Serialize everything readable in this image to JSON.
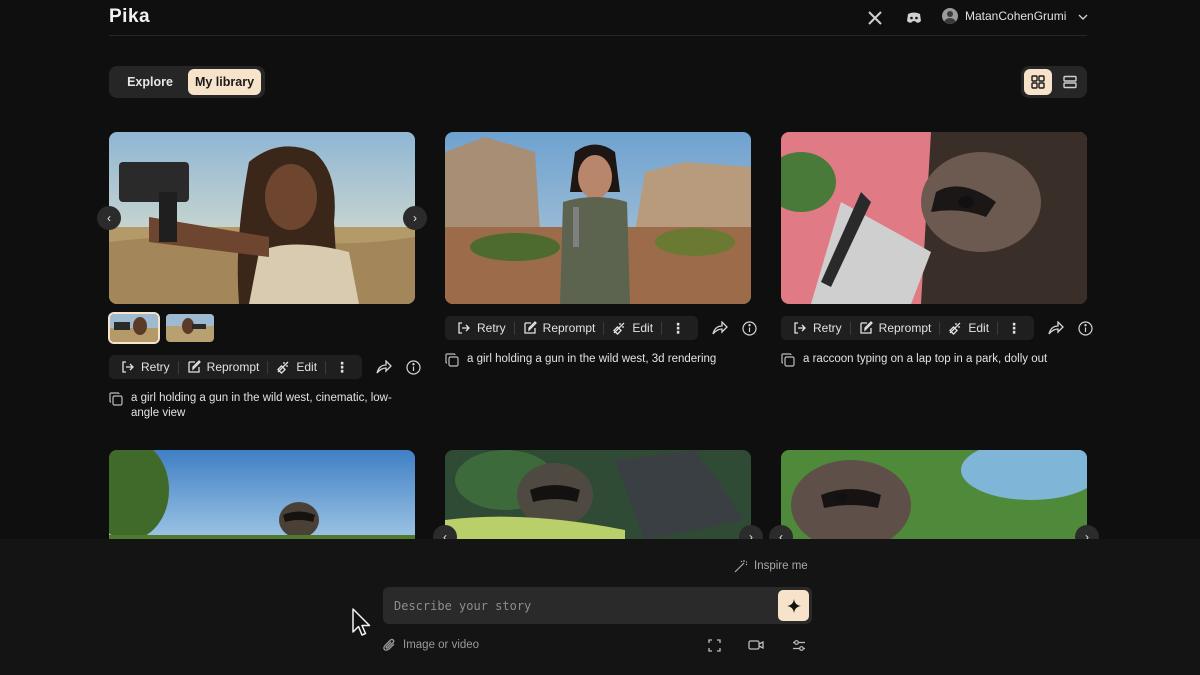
{
  "app": {
    "logo": "Pika"
  },
  "topbar": {
    "user_name": "MatanCohenGrumi",
    "icons": [
      "x-logo-icon",
      "discord-icon",
      "avatar",
      "chevron-down-icon"
    ]
  },
  "tabs": {
    "explore": "Explore",
    "my_library": "My library",
    "active": "my_library"
  },
  "view_toggle": {
    "grid_icon": "grid-view-icon",
    "list_icon": "list-view-icon",
    "active": "grid"
  },
  "actions": {
    "retry": "Retry",
    "reprompt": "Reprompt",
    "edit": "Edit"
  },
  "cards": [
    {
      "caption": "a girl holding a gun in the wild west, cinematic, low-angle view",
      "thumbnails": 2
    },
    {
      "caption": "a girl holding a gun in the wild west, 3d rendering"
    },
    {
      "caption": "a raccoon typing on a lap top in a park, dolly out"
    }
  ],
  "composer": {
    "inspire": "Inspire me",
    "placeholder": "Describe your story",
    "attach": "Image or video"
  },
  "colors": {
    "accent": "#f6e3c9",
    "background": "#0f0f0f",
    "panel": "#262626"
  }
}
